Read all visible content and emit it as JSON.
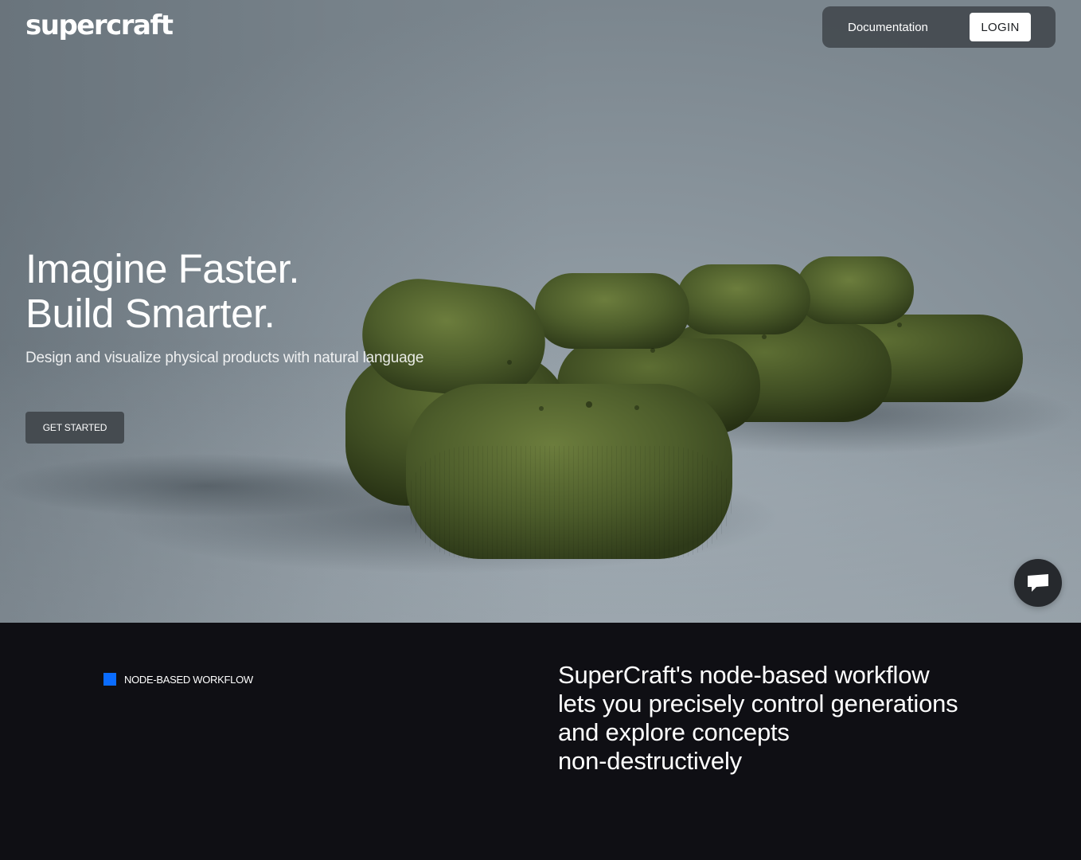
{
  "brand": {
    "logo": "supercraft"
  },
  "nav": {
    "documentation": "Documentation",
    "login": "LOGIN"
  },
  "hero": {
    "headline_line1": "Imagine Faster.",
    "headline_line2": "Build Smarter.",
    "subheadline": "Design and visualize physical products with natural language",
    "cta": "GET STARTED"
  },
  "chat": {
    "icon": "chat-bubble-icon"
  },
  "feature": {
    "tag": "NODE-BASED WORKFLOW",
    "description_lines": [
      "SuperCraft's node-based workflow",
      "lets you precisely control generations",
      "and explore concepts",
      "non-destructively"
    ]
  },
  "colors": {
    "accent": "#0a6cff",
    "hero_bg": "#8a959d",
    "dark_bg": "#0f0f14",
    "sofa_green": "#4a5a2c"
  }
}
